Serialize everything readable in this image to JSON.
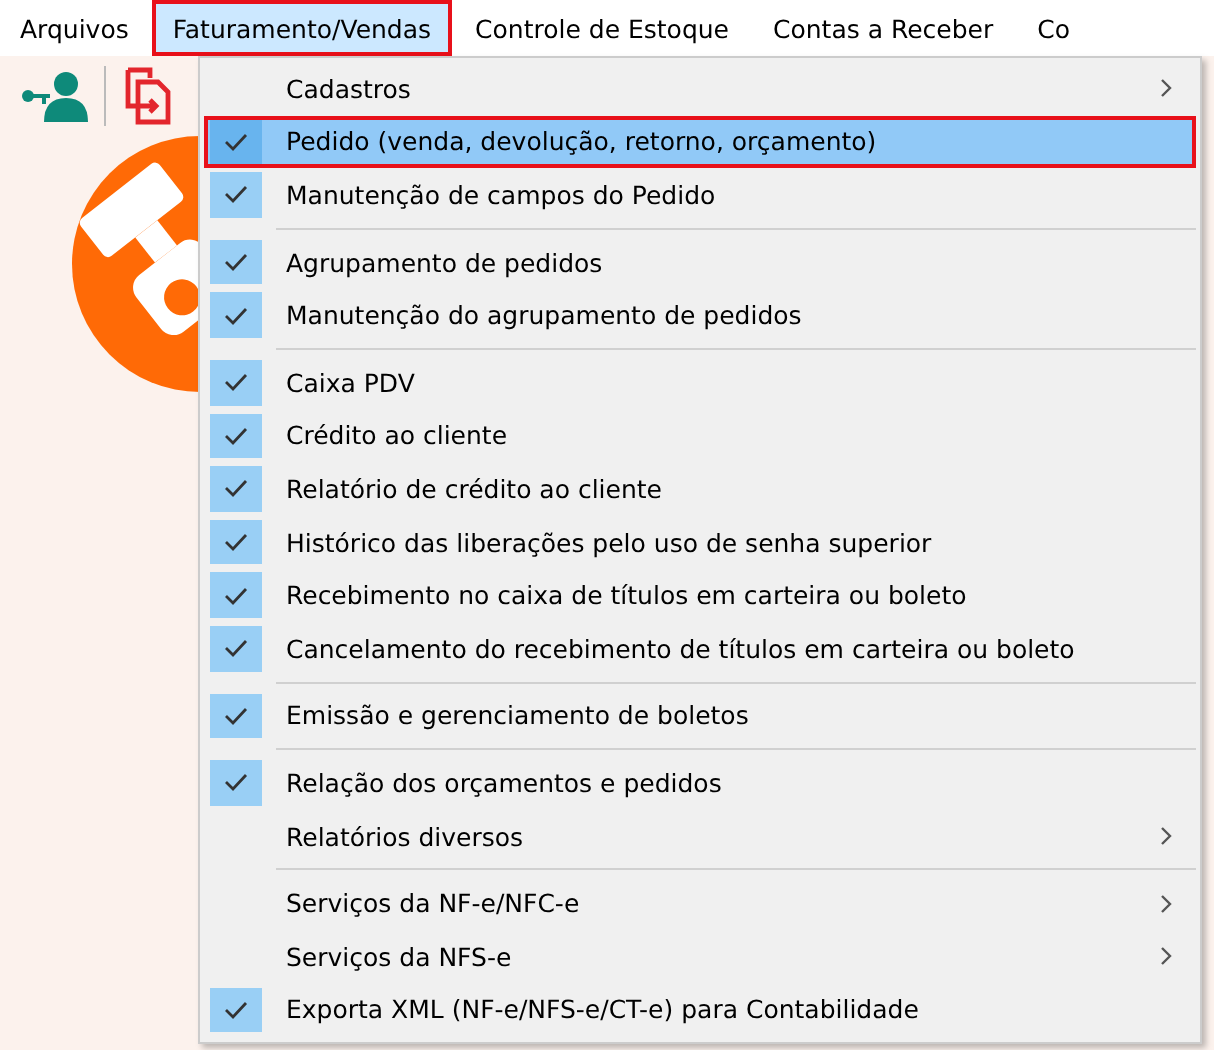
{
  "menu_bar": [
    {
      "label": "Arquivos",
      "selected": false
    },
    {
      "label": "Faturamento/Vendas",
      "selected": true
    },
    {
      "label": "Controle de Estoque",
      "selected": false
    },
    {
      "label": "Contas a Receber",
      "selected": false
    },
    {
      "label": "Co",
      "selected": false
    }
  ],
  "dropdown": [
    {
      "kind": "item",
      "label": "Cadastros",
      "checked": false,
      "submenu": true,
      "selected": false
    },
    {
      "kind": "item",
      "label": "Pedido (venda, devolução, retorno, orçamento)",
      "checked": true,
      "submenu": false,
      "selected": true
    },
    {
      "kind": "item",
      "label": "Manutenção de campos do Pedido",
      "checked": true,
      "submenu": false,
      "selected": false
    },
    {
      "kind": "separator"
    },
    {
      "kind": "item",
      "label": "Agrupamento de pedidos",
      "checked": true,
      "submenu": false,
      "selected": false
    },
    {
      "kind": "item",
      "label": "Manutenção do agrupamento de pedidos",
      "checked": true,
      "submenu": false,
      "selected": false
    },
    {
      "kind": "separator"
    },
    {
      "kind": "item",
      "label": "Caixa PDV",
      "checked": true,
      "submenu": false,
      "selected": false
    },
    {
      "kind": "item",
      "label": "Crédito ao cliente",
      "checked": true,
      "submenu": false,
      "selected": false
    },
    {
      "kind": "item",
      "label": "Relatório de crédito ao cliente",
      "checked": true,
      "submenu": false,
      "selected": false
    },
    {
      "kind": "item",
      "label": "Histórico das liberações pelo uso de senha superior",
      "checked": true,
      "submenu": false,
      "selected": false
    },
    {
      "kind": "item",
      "label": "Recebimento no caixa de títulos em carteira ou boleto",
      "checked": true,
      "submenu": false,
      "selected": false
    },
    {
      "kind": "item",
      "label": "Cancelamento do recebimento de títulos em carteira ou boleto",
      "checked": true,
      "submenu": false,
      "selected": false
    },
    {
      "kind": "separator"
    },
    {
      "kind": "item",
      "label": "Emissão e gerenciamento de boletos",
      "checked": true,
      "submenu": false,
      "selected": false
    },
    {
      "kind": "separator"
    },
    {
      "kind": "item",
      "label": "Relação dos orçamentos e pedidos",
      "checked": true,
      "submenu": false,
      "selected": false
    },
    {
      "kind": "item",
      "label": "Relatórios diversos",
      "checked": false,
      "submenu": true,
      "selected": false
    },
    {
      "kind": "separator"
    },
    {
      "kind": "item",
      "label": "Serviços da NF-e/NFC-e",
      "checked": false,
      "submenu": true,
      "selected": false
    },
    {
      "kind": "item",
      "label": "Serviços da NFS-e",
      "checked": false,
      "submenu": true,
      "selected": false
    },
    {
      "kind": "item",
      "label": "Exporta XML (NF-e/NFS-e/CT-e) para Contabilidade",
      "checked": true,
      "submenu": false,
      "selected": false
    }
  ]
}
